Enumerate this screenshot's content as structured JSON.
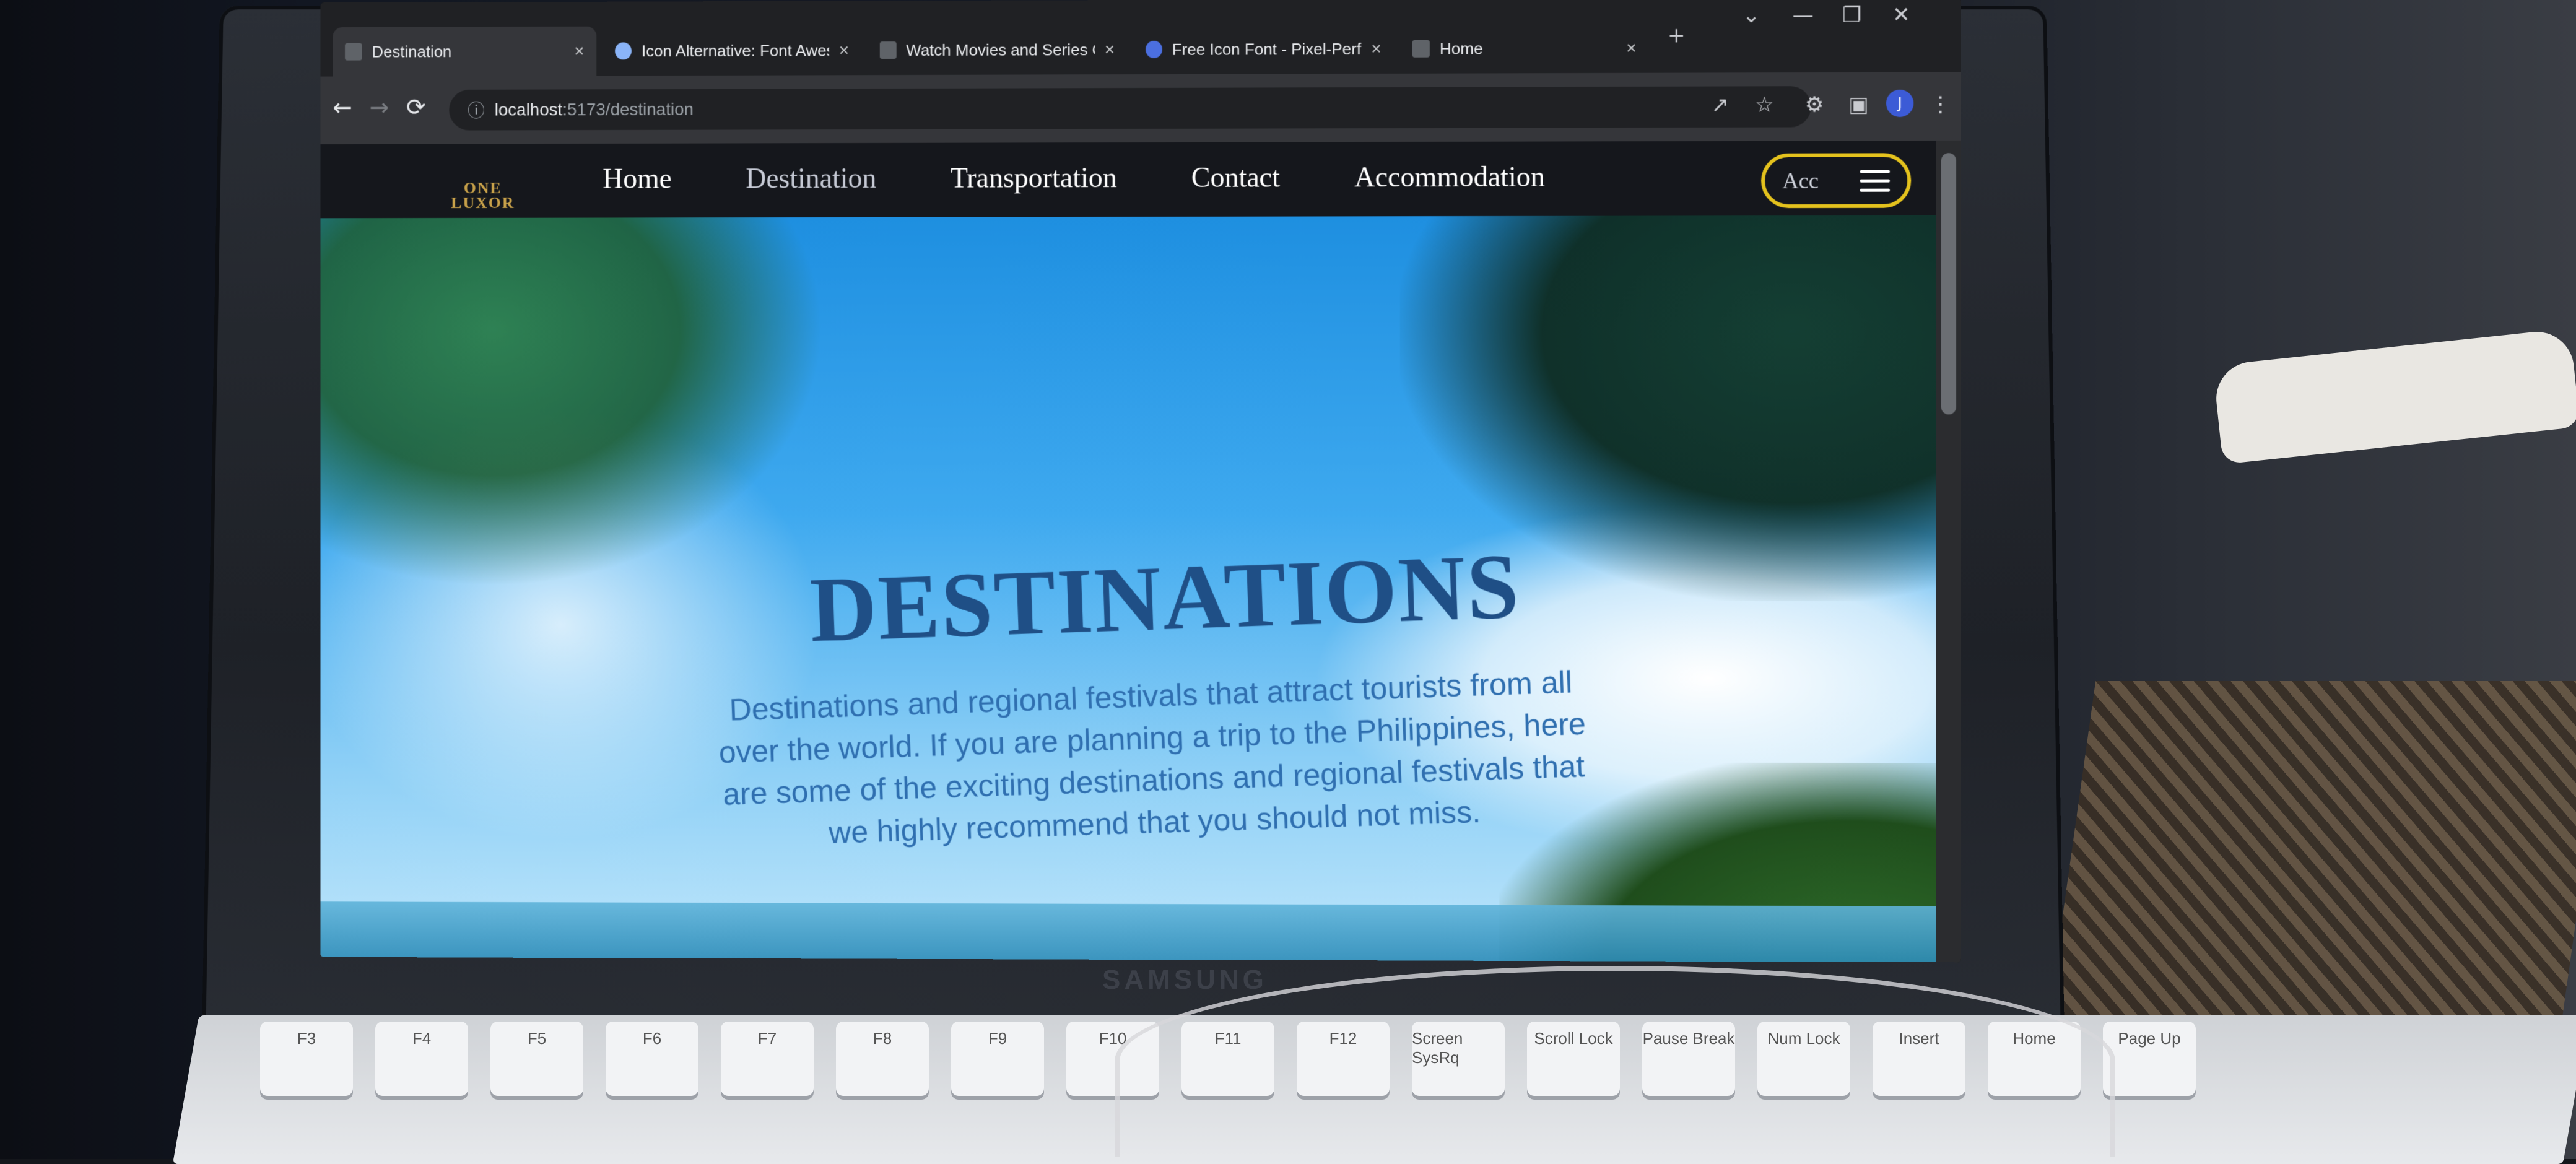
{
  "browser": {
    "tabs": [
      {
        "title": "Destination",
        "active": true,
        "icon": "page-icon"
      },
      {
        "title": "Icon Alternative: Font Awes",
        "active": false,
        "icon": "globe-icon"
      },
      {
        "title": "Watch Movies and Series O",
        "active": false,
        "icon": "ww-logo-icon"
      },
      {
        "title": "Free Icon Font - Pixel-Perfe",
        "active": false,
        "icon": "font-icon"
      },
      {
        "title": "Home",
        "active": false,
        "icon": "page-icon"
      }
    ],
    "new_tab_glyph": "+",
    "close_glyph": "×",
    "address": {
      "host": "localhost",
      "path": ":5173/destination"
    },
    "profile_initial": "J"
  },
  "site": {
    "logo": {
      "line1": "ONE",
      "line2": "LUXOR"
    },
    "nav": [
      {
        "label": "Home",
        "current": false
      },
      {
        "label": "Destination",
        "current": true
      },
      {
        "label": "Transportation",
        "current": false
      },
      {
        "label": "Contact",
        "current": false
      },
      {
        "label": "Accommodation",
        "current": false
      }
    ],
    "account_button_label": "Acc",
    "hero": {
      "title": "DESTINATIONS",
      "description": "Destinations and regional festivals that attract tourists from all over the world. If you are planning a trip to the Philippines, here are some of the exciting destinations and regional festivals that we highly recommend that you should not miss."
    }
  },
  "laptop_brand": "SAMSUNG",
  "keyboard_keys": [
    "F3",
    "F4",
    "F5",
    "F6",
    "F7",
    "F8",
    "F9",
    "F10",
    "F11",
    "F12",
    "Screen SysRq",
    "Scroll Lock",
    "Pause Break",
    "Num Lock",
    "Insert",
    "Home",
    "Page Up"
  ],
  "colors": {
    "accent_button_border": "#e4c21d",
    "hero_title": "#1f4f86",
    "hero_text": "#2f6fb0",
    "logo_gold": "#c9a24a"
  }
}
